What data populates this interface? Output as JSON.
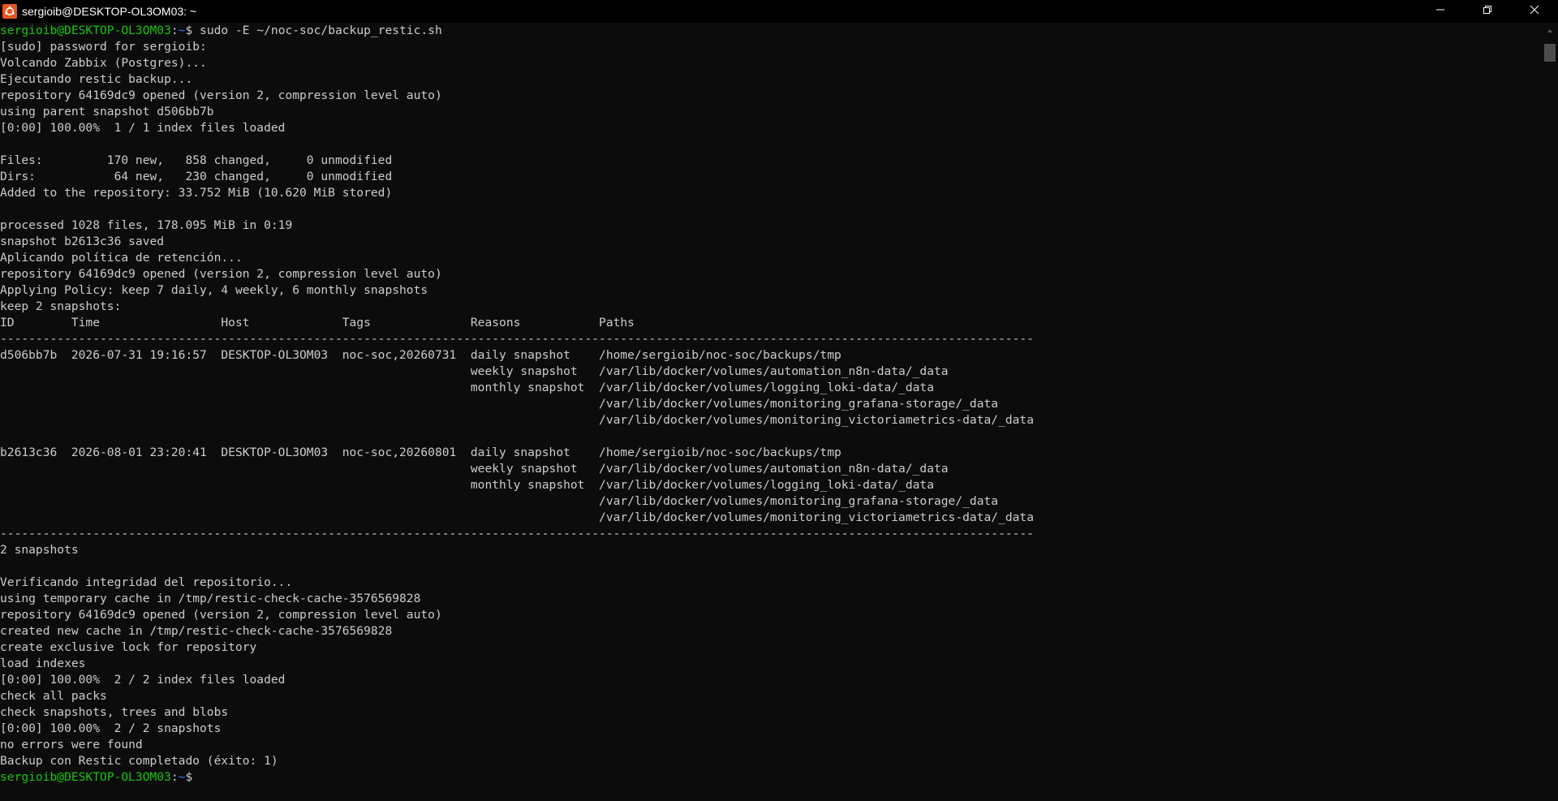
{
  "window": {
    "title": "sergioib@DESKTOP-OL3OM03: ~",
    "icon": "ubuntu-icon",
    "controls": [
      "minimize-icon",
      "restore-icon",
      "close-icon"
    ]
  },
  "prompt": {
    "user_host": "sergioib@DESKTOP-OL3OM03",
    "sep": ":",
    "path": "~",
    "symbol": "$"
  },
  "command": " sudo -E ~/noc-soc/backup_restic.sh",
  "output": [
    "[sudo] password for sergioib:",
    "Volcando Zabbix (Postgres)...",
    "Ejecutando restic backup...",
    "repository 64169dc9 opened (version 2, compression level auto)",
    "using parent snapshot d506bb7b",
    "[0:00] 100.00%  1 / 1 index files loaded",
    "",
    "Files:         170 new,   858 changed,     0 unmodified",
    "Dirs:           64 new,   230 changed,     0 unmodified",
    "Added to the repository: 33.752 MiB (10.620 MiB stored)",
    "",
    "processed 1028 files, 178.095 MiB in 0:19",
    "snapshot b2613c36 saved",
    "Aplicando política de retención...",
    "repository 64169dc9 opened (version 2, compression level auto)",
    "Applying Policy: keep 7 daily, 4 weekly, 6 monthly snapshots",
    "keep 2 snapshots:",
    "ID        Time                 Host             Tags              Reasons           Paths",
    "-------------------------------------------------------------------------------------------------------------------------------------------------",
    "d506bb7b  2026-07-31 19:16:57  DESKTOP-OL3OM03  noc-soc,20260731  daily snapshot    /home/sergioib/noc-soc/backups/tmp",
    "                                                                  weekly snapshot   /var/lib/docker/volumes/automation_n8n-data/_data",
    "                                                                  monthly snapshot  /var/lib/docker/volumes/logging_loki-data/_data",
    "                                                                                    /var/lib/docker/volumes/monitoring_grafana-storage/_data",
    "                                                                                    /var/lib/docker/volumes/monitoring_victoriametrics-data/_data",
    "",
    "b2613c36  2026-08-01 23:20:41  DESKTOP-OL3OM03  noc-soc,20260801  daily snapshot    /home/sergioib/noc-soc/backups/tmp",
    "                                                                  weekly snapshot   /var/lib/docker/volumes/automation_n8n-data/_data",
    "                                                                  monthly snapshot  /var/lib/docker/volumes/logging_loki-data/_data",
    "                                                                                    /var/lib/docker/volumes/monitoring_grafana-storage/_data",
    "                                                                                    /var/lib/docker/volumes/monitoring_victoriametrics-data/_data",
    "-------------------------------------------------------------------------------------------------------------------------------------------------",
    "2 snapshots",
    "",
    "Verificando integridad del repositorio...",
    "using temporary cache in /tmp/restic-check-cache-3576569828",
    "repository 64169dc9 opened (version 2, compression level auto)",
    "created new cache in /tmp/restic-check-cache-3576569828",
    "create exclusive lock for repository",
    "load indexes",
    "[0:00] 100.00%  2 / 2 index files loaded",
    "check all packs",
    "check snapshots, trees and blobs",
    "[0:00] 100.00%  2 / 2 snapshots",
    "no errors were found",
    "Backup con Restic completado (éxito: 1)"
  ],
  "final_command": "",
  "colors": {
    "background": "#0c0c0c",
    "foreground": "#cccccc",
    "prompt_user": "#16c60c",
    "prompt_path": "#3b78ff",
    "titlebar": "#000000"
  }
}
